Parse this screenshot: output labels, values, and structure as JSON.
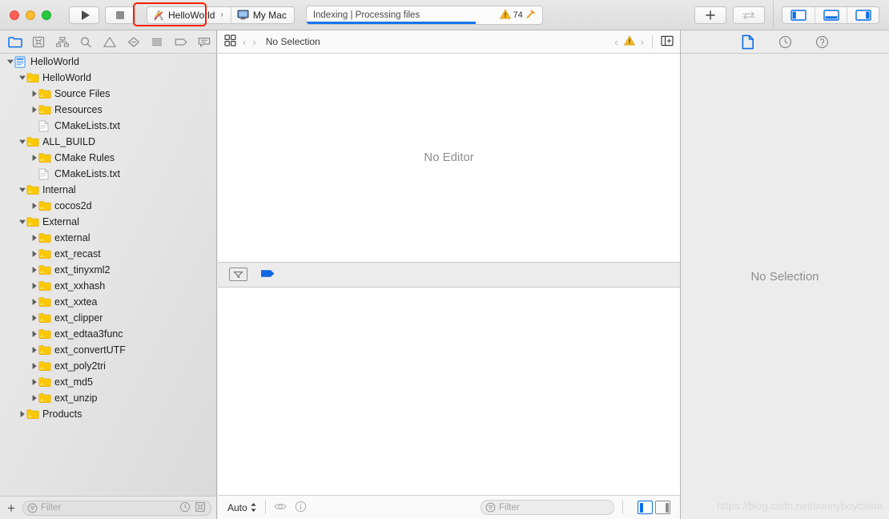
{
  "toolbar": {
    "run_label": "Run",
    "stop_label": "Stop",
    "scheme": {
      "name": "HelloWorld",
      "destination": "My Mac",
      "chevron": "›"
    },
    "status": {
      "text": "Indexing | Processing files",
      "warning_count": "74",
      "progress_percent": 72
    },
    "add_label": "+",
    "buttons": {
      "plus": "add-button",
      "swap": "swap-button",
      "toggle_navigator": "toggle-navigator",
      "toggle_debug": "toggle-debug-area",
      "toggle_inspector": "toggle-inspector"
    }
  },
  "navigator": {
    "tabs": [
      {
        "name": "project-navigator",
        "icon": "folder-icon",
        "selected": true
      },
      {
        "name": "source-control-navigator",
        "icon": "source-control-icon",
        "selected": false
      },
      {
        "name": "symbol-navigator",
        "icon": "hierarchy-icon",
        "selected": false
      },
      {
        "name": "find-navigator",
        "icon": "search-icon",
        "selected": false
      },
      {
        "name": "issue-navigator",
        "icon": "warning-triangle-icon",
        "selected": false
      },
      {
        "name": "test-navigator",
        "icon": "diamond-minus-icon",
        "selected": false
      },
      {
        "name": "debug-navigator",
        "icon": "list-icon",
        "selected": false
      },
      {
        "name": "breakpoint-navigator",
        "icon": "tag-icon",
        "selected": false
      },
      {
        "name": "report-navigator",
        "icon": "speech-bubble-icon",
        "selected": false
      }
    ],
    "tree": [
      {
        "label": "HelloWorld",
        "depth": 0,
        "icon": "project-icon",
        "twisty": "open"
      },
      {
        "label": "HelloWorld",
        "depth": 1,
        "icon": "folder-icon",
        "twisty": "open"
      },
      {
        "label": "Source Files",
        "depth": 2,
        "icon": "folder-icon",
        "twisty": "closed"
      },
      {
        "label": "Resources",
        "depth": 2,
        "icon": "folder-icon",
        "twisty": "closed"
      },
      {
        "label": "CMakeLists.txt",
        "depth": 2,
        "icon": "file-icon",
        "twisty": "none"
      },
      {
        "label": "ALL_BUILD",
        "depth": 1,
        "icon": "folder-icon",
        "twisty": "open"
      },
      {
        "label": "CMake Rules",
        "depth": 2,
        "icon": "folder-icon",
        "twisty": "closed"
      },
      {
        "label": "CMakeLists.txt",
        "depth": 2,
        "icon": "file-icon",
        "twisty": "none"
      },
      {
        "label": "Internal",
        "depth": 1,
        "icon": "folder-icon",
        "twisty": "open"
      },
      {
        "label": "cocos2d",
        "depth": 2,
        "icon": "folder-icon",
        "twisty": "closed"
      },
      {
        "label": "External",
        "depth": 1,
        "icon": "folder-icon",
        "twisty": "open"
      },
      {
        "label": "external",
        "depth": 2,
        "icon": "folder-icon",
        "twisty": "closed"
      },
      {
        "label": "ext_recast",
        "depth": 2,
        "icon": "folder-icon",
        "twisty": "closed"
      },
      {
        "label": "ext_tinyxml2",
        "depth": 2,
        "icon": "folder-icon",
        "twisty": "closed"
      },
      {
        "label": "ext_xxhash",
        "depth": 2,
        "icon": "folder-icon",
        "twisty": "closed"
      },
      {
        "label": "ext_xxtea",
        "depth": 2,
        "icon": "folder-icon",
        "twisty": "closed"
      },
      {
        "label": "ext_clipper",
        "depth": 2,
        "icon": "folder-icon",
        "twisty": "closed"
      },
      {
        "label": "ext_edtaa3func",
        "depth": 2,
        "icon": "folder-icon",
        "twisty": "closed"
      },
      {
        "label": "ext_convertUTF",
        "depth": 2,
        "icon": "folder-icon",
        "twisty": "closed"
      },
      {
        "label": "ext_poly2tri",
        "depth": 2,
        "icon": "folder-icon",
        "twisty": "closed"
      },
      {
        "label": "ext_md5",
        "depth": 2,
        "icon": "folder-icon",
        "twisty": "closed"
      },
      {
        "label": "ext_unzip",
        "depth": 2,
        "icon": "folder-icon",
        "twisty": "closed"
      },
      {
        "label": "Products",
        "depth": 1,
        "icon": "folder-icon",
        "twisty": "closed"
      }
    ],
    "filter": {
      "placeholder": "Filter",
      "value": "",
      "recent_icon": "clock-icon",
      "scm_icon": "source-control-icon"
    },
    "add_label": "+"
  },
  "editor": {
    "jumpbar": {
      "grid_icon": "related-items-icon",
      "back": "‹",
      "forward": "›",
      "title": "No Selection",
      "issue_prev": "‹",
      "issue_next": "›",
      "issue_icon": "warning-triangle-icon",
      "add_editor_icon": "add-editor-icon"
    },
    "placeholder": "No Editor",
    "debug_toolbar": {
      "filter_icon": "collapse-filter-icon",
      "flag_icon": "blue-flag-icon"
    },
    "bottom_bar": {
      "scope_label": "Auto",
      "eye_icon": "eye-icon",
      "info_icon": "info-icon",
      "filter_placeholder": "Filter",
      "filter_value": "",
      "split_left": "variables-view-toggle",
      "split_right": "console-view-toggle"
    }
  },
  "inspector": {
    "tabs": [
      {
        "name": "file-inspector",
        "icon": "file-icon",
        "selected": true
      },
      {
        "name": "history-inspector",
        "icon": "clock-icon",
        "selected": false
      },
      {
        "name": "quick-help-inspector",
        "icon": "help-icon",
        "selected": false
      }
    ],
    "placeholder": "No Selection"
  },
  "watermark": "https://blog.csdn.net/sunnyboychina",
  "colors": {
    "accent_blue": "#0b6ee8",
    "progress_blue": "#1276f0",
    "folder_yellow": "#fcc800",
    "warning_yellow": "#f5bc24",
    "annotation_red": "#ff1e00"
  }
}
